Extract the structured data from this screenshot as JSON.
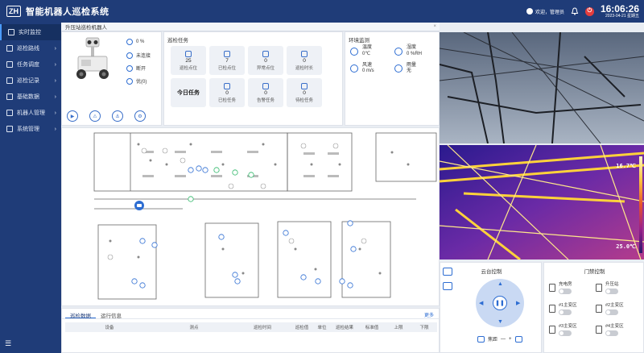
{
  "header": {
    "logo_text": "ZH",
    "title": "智能机器人巡检系统",
    "welcome": "欢迎，管理员",
    "time": "16:06:26",
    "date": "2023-04-21 星期五"
  },
  "sidebar": {
    "items": [
      {
        "label": "实时监控",
        "active": true
      },
      {
        "label": "巡检路线"
      },
      {
        "label": "任务调度"
      },
      {
        "label": "巡检记录"
      },
      {
        "label": "基础数据"
      },
      {
        "label": "机器人管理"
      },
      {
        "label": "系统管理"
      }
    ],
    "toggle": "☰"
  },
  "breadcrumb": {
    "label": "升压站巡检机器人",
    "close": "×"
  },
  "robot": {
    "battery": "0 %",
    "connection": "未连接",
    "link": "断开",
    "quality": "优(0)",
    "buttons": [
      "▶",
      "⚠",
      "⚓",
      "⚙"
    ]
  },
  "tasks": {
    "title": "巡检任务",
    "cards": [
      {
        "value": "25",
        "label": "巡检点位"
      },
      {
        "value": "7",
        "label": "已检点位"
      },
      {
        "value": "0",
        "label": "异常点位"
      },
      {
        "value": "0",
        "label": "巡检时长"
      },
      {
        "value": "",
        "label": "今日任务",
        "big": true
      },
      {
        "value": "0",
        "label": "已检任务"
      },
      {
        "value": "0",
        "label": "告警任务"
      },
      {
        "value": "0",
        "label": "待检任务"
      }
    ]
  },
  "environment": {
    "title": "环境监测",
    "items": [
      {
        "label": "温度",
        "value": "0℃"
      },
      {
        "label": "湿度",
        "value": "0 %RH"
      },
      {
        "label": "风速",
        "value": "0 m/s"
      },
      {
        "label": "雨量",
        "value": "无"
      }
    ]
  },
  "data_panel": {
    "tabs": [
      "巡检数据",
      "运行信息"
    ],
    "more": "更多",
    "columns": [
      "设备",
      "测点",
      "巡检时间",
      "巡检值",
      "单位",
      "巡检结果",
      "标准值",
      "上限",
      "下限"
    ]
  },
  "thermal": {
    "top_temp": "16.7℃",
    "bottom_temp": "25.0℃"
  },
  "ptz": {
    "title": "云台控制",
    "focus_label": "焦距",
    "minus": "—",
    "plus": "+"
  },
  "doors": {
    "title": "门禁控制",
    "items": [
      "充电房",
      "升压站",
      "#1主变区",
      "#2主变区",
      "#3主变区",
      "#4主变区"
    ]
  }
}
